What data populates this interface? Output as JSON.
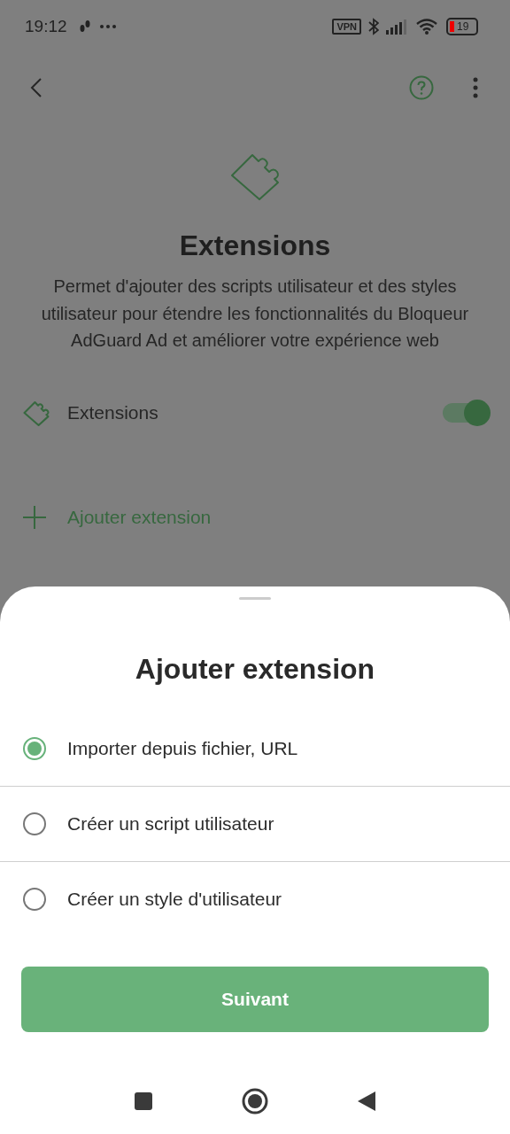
{
  "status_bar": {
    "time": "19:12",
    "vpn": "VPN",
    "battery": "19"
  },
  "header": {
    "title": "Extensions",
    "description": "Permet d'ajouter des scripts utilisateur et des styles utilisateur pour étendre les fonctionnalités du Bloqueur AdGuard Ad et améliorer votre expérience web"
  },
  "extensions_switch": {
    "label": "Extensions",
    "on": true
  },
  "add_link": {
    "label": "Ajouter extension"
  },
  "sheet": {
    "title": "Ajouter extension",
    "options": [
      {
        "label": "Importer depuis fichier, URL",
        "selected": true
      },
      {
        "label": "Créer un script utilisateur",
        "selected": false
      },
      {
        "label": "Créer un style d'utilisateur",
        "selected": false
      }
    ],
    "button": "Suivant"
  }
}
